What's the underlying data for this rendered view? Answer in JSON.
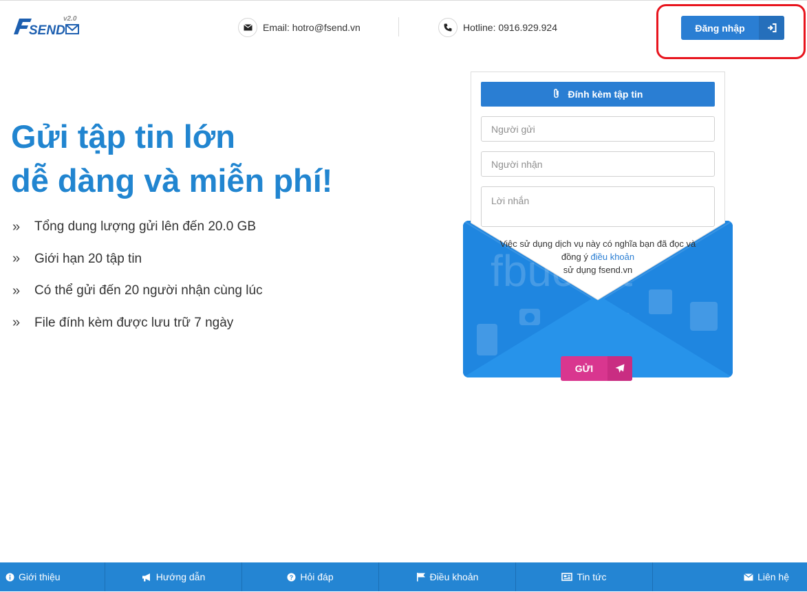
{
  "header": {
    "logo_text": "FSEND",
    "logo_version": "v2.0",
    "email_label": "Email: hotro@fsend.vn",
    "hotline_label": "Hotline: 0916.929.924",
    "login_label": "Đăng nhập"
  },
  "hero": {
    "title_line1": "Gửi tập tin lớn",
    "title_line2": "dễ dàng và miễn phí!",
    "features": [
      "Tổng dung lượng gửi lên đến 20.0 GB",
      "Giới hạn 20 tập tin",
      "Có thể gửi đến 20 người nhận cùng lúc",
      "File đính kèm được lưu trữ 7 ngày"
    ]
  },
  "form": {
    "attach_label": "Đính kèm tập tin",
    "sender_placeholder": "Người gửi",
    "recipient_placeholder": "Người nhận",
    "message_placeholder": "Lời nhắn",
    "terms_prefix": "Việc sử dụng dịch vụ này có nghĩa bạn đã đọc và đồng ý",
    "terms_link": "điều khoản",
    "terms_suffix": "sử dụng fsend.vn",
    "send_label": "GỬI",
    "envelope_watermark": "fbucket"
  },
  "footer": {
    "items": [
      {
        "label": "Giới thiệu",
        "icon": "info-icon"
      },
      {
        "label": "Hướng dẫn",
        "icon": "megaphone-icon"
      },
      {
        "label": "Hỏi đáp",
        "icon": "question-icon"
      },
      {
        "label": "Điều khoản",
        "icon": "flag-icon"
      },
      {
        "label": "Tin tức",
        "icon": "newspaper-icon"
      },
      {
        "label": "Liên hệ",
        "icon": "envelope-icon"
      }
    ]
  },
  "colors": {
    "brand_blue": "#2185d0",
    "button_blue": "#2a7ed3",
    "send_pink": "#d9368f",
    "highlight_red": "#e8141d"
  }
}
